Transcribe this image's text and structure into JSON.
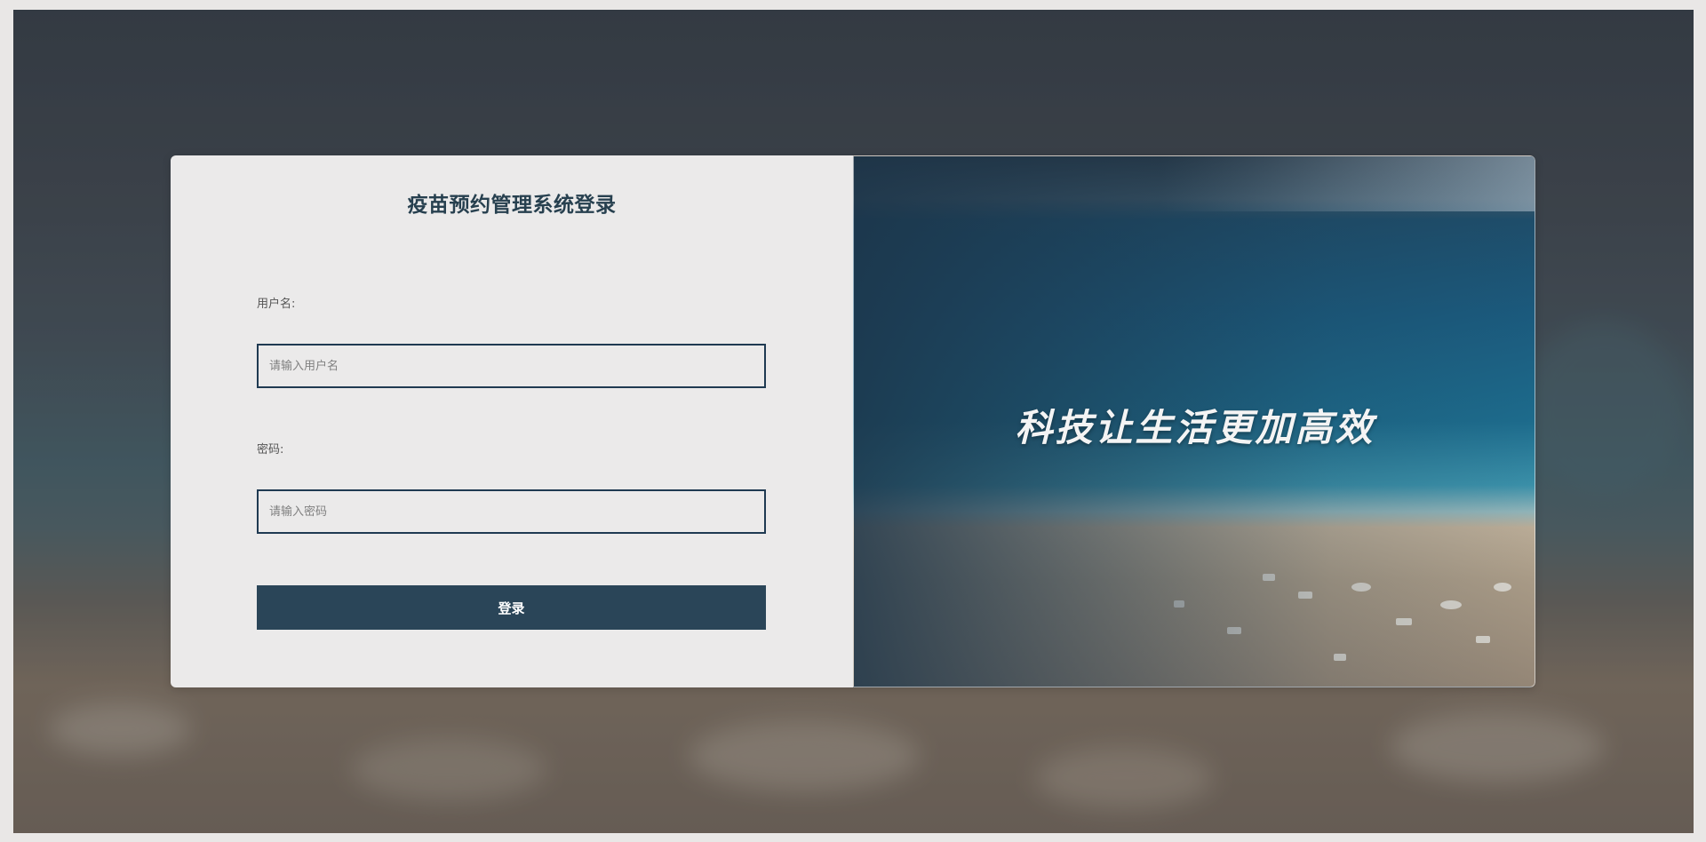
{
  "login_form": {
    "title": "疫苗预约管理系统登录",
    "username_label": "用户名:",
    "username_placeholder": "请输入用户名",
    "username_value": "",
    "password_label": "密码:",
    "password_placeholder": "请输入密码",
    "password_value": "",
    "submit_label": "登录"
  },
  "banner": {
    "slogan": "科技让生活更加高效"
  },
  "colors": {
    "primary": "#2a4558",
    "input_border": "#1f3a52",
    "title_text": "#27404f",
    "panel_background": "#ebeaea"
  }
}
